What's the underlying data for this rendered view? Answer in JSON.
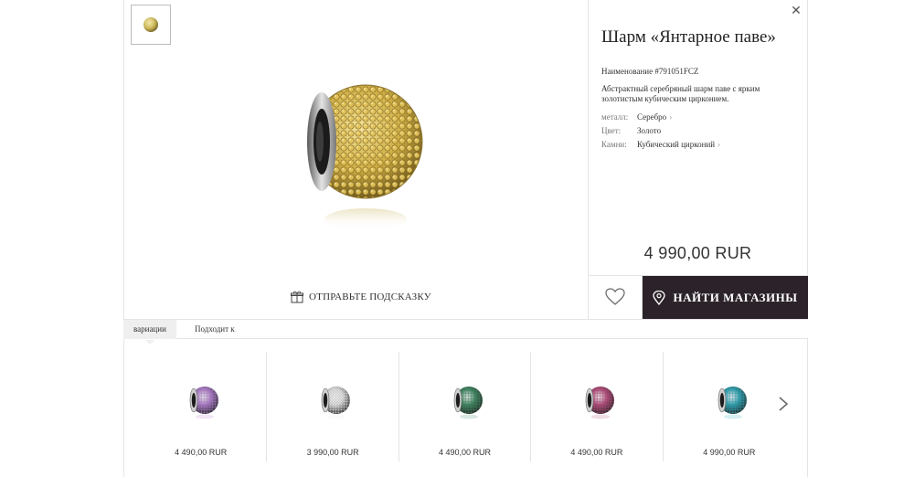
{
  "product": {
    "title": "Шарм «Янтарное паве»",
    "sku": "Наименование #791051FCZ",
    "description": "Абстрактный серебряный шарм паве с ярким золотистым кубическим цирконием.",
    "attributes": [
      {
        "key": "металл:",
        "value": "Серебро",
        "link": true
      },
      {
        "key": "Цвет:",
        "value": "Золото",
        "link": false
      },
      {
        "key": "Камни:",
        "value": "Кубический цирконий",
        "link": true
      }
    ],
    "price": "4 990,00 RUR",
    "stone_color": "#d9b94a"
  },
  "actions": {
    "hint_label": "ОТПРАВЬТЕ ПОДСКАЗКУ",
    "find_stores_label": "НАЙТИ МАГАЗИНЫ",
    "close_symbol": "✕"
  },
  "tabs": [
    {
      "label": "вариации",
      "active": true
    },
    {
      "label": "Подходит к",
      "active": false
    }
  ],
  "variations": [
    {
      "price": "4 490,00 RUR",
      "color": "#b27fcf"
    },
    {
      "price": "3 990,00 RUR",
      "color": "#e8e8e8"
    },
    {
      "price": "4 490,00 RUR",
      "color": "#3f8a63"
    },
    {
      "price": "4 490,00 RUR",
      "color": "#b94d7e"
    },
    {
      "price": "4 990,00 RUR",
      "color": "#2fa8b8"
    }
  ]
}
